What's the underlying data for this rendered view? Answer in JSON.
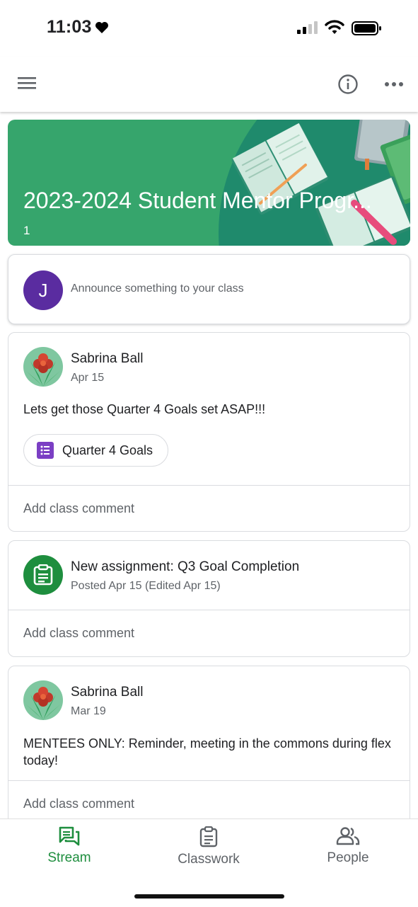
{
  "status_bar": {
    "time": "11:03"
  },
  "banner": {
    "title": "2023-2024 Student Mentor Progr...",
    "section": "1",
    "colors": {
      "background": "#36a56c",
      "accent_circle": "#1f8a6c"
    }
  },
  "announce": {
    "avatar_initial": "J",
    "placeholder": "Announce something to your class"
  },
  "posts": [
    {
      "author": "Sabrina Ball",
      "date": "Apr 15",
      "body": "Lets get those Quarter 4 Goals set ASAP!!!",
      "attachment": {
        "label": "Quarter 4 Goals",
        "icon": "forms-icon"
      },
      "comment_label": "Add class comment"
    },
    {
      "type": "assignment",
      "title": "New assignment: Q3 Goal Completion",
      "meta": "Posted Apr 15 (Edited Apr 15)",
      "icon": "assignment-icon",
      "comment_label": "Add class comment"
    },
    {
      "author": "Sabrina Ball",
      "date": "Mar 19",
      "body": "MENTEES ONLY: Reminder, meeting in the commons during flex today!",
      "comment_label": "Add class comment"
    }
  ],
  "bottom_nav": {
    "items": [
      {
        "label": "Stream",
        "icon": "stream-icon",
        "active": true
      },
      {
        "label": "Classwork",
        "icon": "classwork-icon",
        "active": false
      },
      {
        "label": "People",
        "icon": "people-icon",
        "active": false
      }
    ],
    "active_color": "#1e8e3e"
  }
}
